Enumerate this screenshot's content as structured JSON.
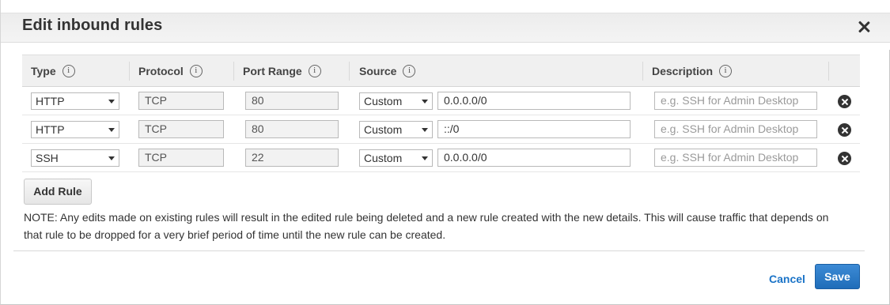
{
  "dialog": {
    "title": "Edit inbound rules",
    "close_icon": "close-icon"
  },
  "table": {
    "headers": {
      "type": "Type",
      "protocol": "Protocol",
      "port_range": "Port Range",
      "source": "Source",
      "description": "Description"
    },
    "info_glyph": "i",
    "rows": [
      {
        "type": "HTTP",
        "protocol": "TCP",
        "port_range": "80",
        "source_mode": "Custom",
        "source_value": "0.0.0.0/0",
        "description_placeholder": "e.g. SSH for Admin Desktop"
      },
      {
        "type": "HTTP",
        "protocol": "TCP",
        "port_range": "80",
        "source_mode": "Custom",
        "source_value": "::/0",
        "description_placeholder": "e.g. SSH for Admin Desktop"
      },
      {
        "type": "SSH",
        "protocol": "TCP",
        "port_range": "22",
        "source_mode": "Custom",
        "source_value": "0.0.0.0/0",
        "description_placeholder": "e.g. SSH for Admin Desktop"
      }
    ]
  },
  "actions": {
    "add_rule": "Add Rule",
    "cancel": "Cancel",
    "save": "Save"
  },
  "note": "NOTE: Any edits made on existing rules will result in the edited rule being deleted and a new rule created with the new details. This will cause traffic that depends on that rule to be dropped for a very brief period of time until the new rule can be created.",
  "colors": {
    "primary_button": "#1f6db9",
    "link": "#1a73c7",
    "header_bg": "#f0f0f0"
  }
}
